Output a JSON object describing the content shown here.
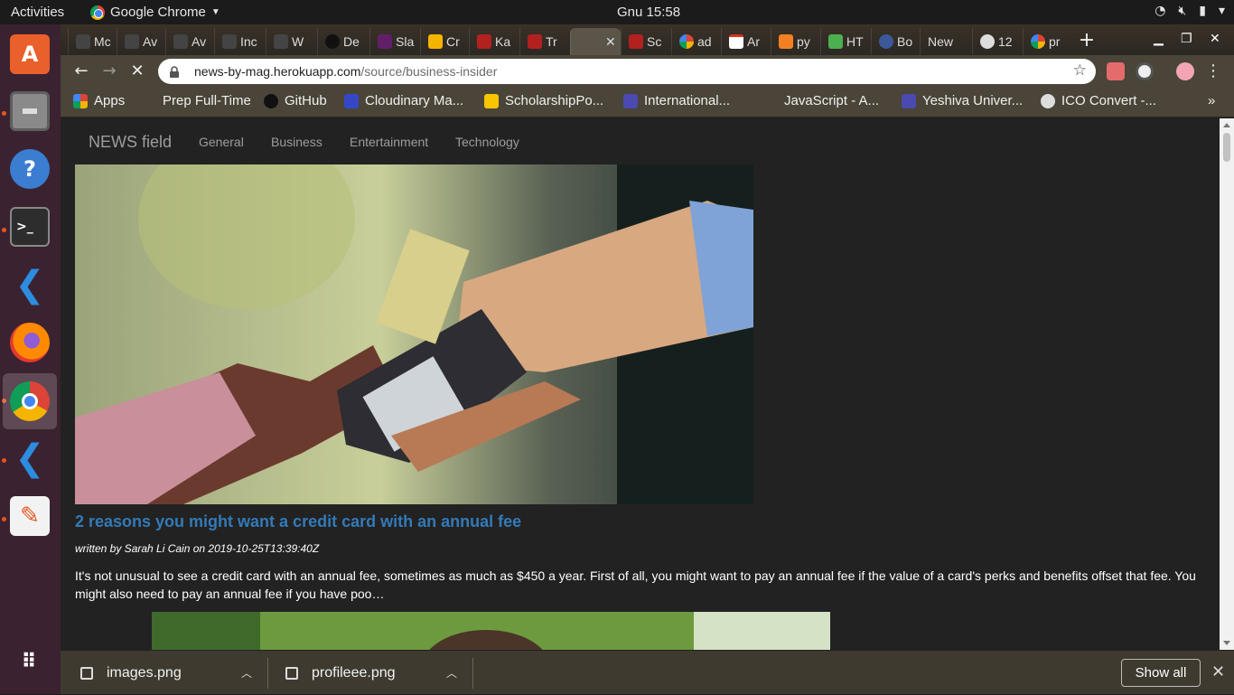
{
  "topbar": {
    "activities": "Activities",
    "app_name": "Google Chrome",
    "clock": "Gnu 15:58",
    "tray": [
      "wifi-icon",
      "volume-muted-icon",
      "battery-icon",
      "power-menu-icon"
    ]
  },
  "dock": [
    "ubuntu-software",
    "files",
    "help",
    "terminal",
    "vscode",
    "firefox",
    "chrome",
    "vscode",
    "text-editor",
    "show-applications"
  ],
  "tabs": [
    "Mc",
    "Av",
    "Av",
    "Inc",
    "W",
    "De",
    "Sla",
    "Cr",
    "Ka",
    "Tr",
    "",
    "Sc",
    "ad",
    "Ar",
    "py",
    "HT",
    "Bo",
    "New",
    "12",
    "pr"
  ],
  "toolbar": {
    "url_host": "news-by-mag.herokuapp.com",
    "url_path": "/source/business-insider"
  },
  "bookmarks": [
    "Apps",
    "Prep Full-Time",
    "GitHub",
    "Cloudinary Ma...",
    "ScholarshipPo...",
    "International...",
    "JavaScript - A...",
    "Yeshiva Univer...",
    "ICO Convert -..."
  ],
  "site": {
    "brand": "NEWS field",
    "nav": [
      "General",
      "Business",
      "Entertainment",
      "Technology"
    ]
  },
  "article": {
    "title": "2 reasons you might want a credit card with an annual fee",
    "byline": "written by Sarah Li Cain on 2019-10-25T13:39:40Z",
    "description": "It's not unusual to see a credit card with an annual fee, sometimes as much as $450 a year. First of all, you might want to pay an annual fee if the value of a card's perks and benefits offset that fee. You might also need to pay an annual fee if you have poo…"
  },
  "downloads": {
    "items": [
      "images.png",
      "profileee.png"
    ],
    "show_all": "Show all"
  }
}
